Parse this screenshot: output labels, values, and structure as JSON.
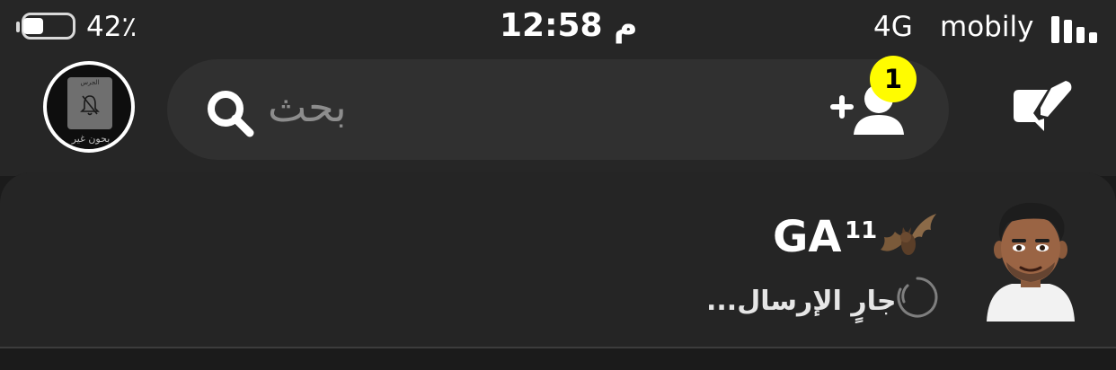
{
  "status_bar": {
    "battery_percent": "42٪",
    "time": "12:58 م",
    "network": "4G",
    "carrier": "mobily"
  },
  "header": {
    "search_placeholder": "بحث",
    "friend_requests_badge": "1",
    "avatar_card_text": "الجرس",
    "avatar_caption": "بحون غير"
  },
  "chat": {
    "contact_name": "GA",
    "contact_superscript": "11",
    "status": "جارٍ الإرسال..."
  },
  "icons": {
    "search": "search-icon",
    "add_friend": "add-friend-icon",
    "new_chat": "new-chat-icon",
    "bat": "bat-emoji-icon",
    "sending": "sending-spinner-icon",
    "avatar": "bitmoji-avatar",
    "bell": "bell-slash-icon"
  },
  "colors": {
    "badge": "#fffc00",
    "header_bg": "#262626",
    "search_bg": "#303030",
    "list_bg": "#252525"
  }
}
